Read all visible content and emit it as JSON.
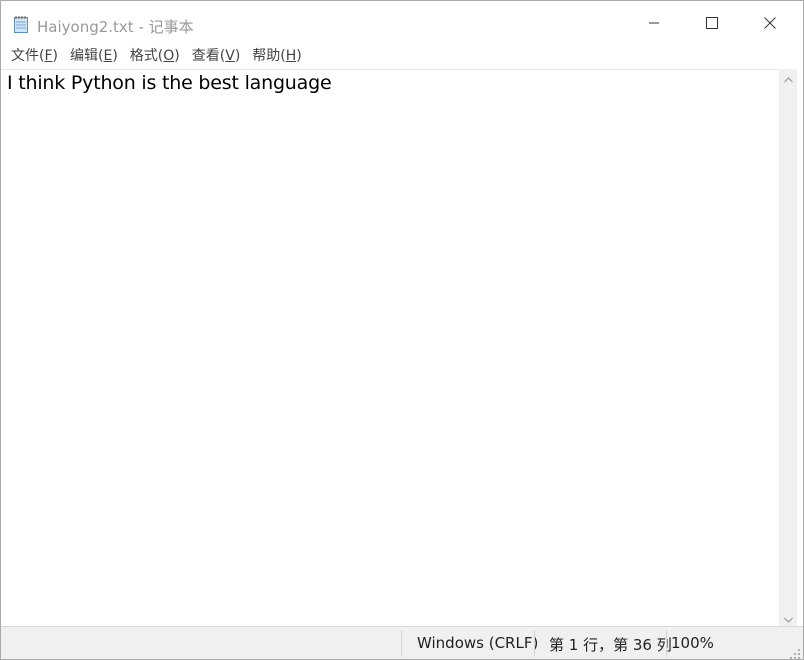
{
  "window": {
    "title": "Haiyong2.txt - 记事本"
  },
  "icons": {
    "app": "notepad-icon",
    "minimize": "minimize-icon",
    "maximize": "maximize-icon",
    "close": "close-icon",
    "scroll_up": "chevron-up-icon",
    "scroll_down": "chevron-down-icon",
    "grip": "resize-grip-icon"
  },
  "menu": {
    "items": [
      {
        "label": "文件(",
        "key": "F",
        "end": ")"
      },
      {
        "label": "编辑(",
        "key": "E",
        "end": ")"
      },
      {
        "label": "格式(",
        "key": "O",
        "end": ")"
      },
      {
        "label": "查看(",
        "key": "V",
        "end": ")"
      },
      {
        "label": "帮助(",
        "key": "H",
        "end": ")"
      }
    ]
  },
  "editor": {
    "content": "I think Python is the best language"
  },
  "status": {
    "encoding": "Windows (CRLF)",
    "position": "第 1 行，第 36 列",
    "zoom": "100%"
  },
  "colors": {
    "title_text": "#999999",
    "status_bg": "#f0f0f0",
    "scrollbar_bg": "#f0f0f0"
  }
}
